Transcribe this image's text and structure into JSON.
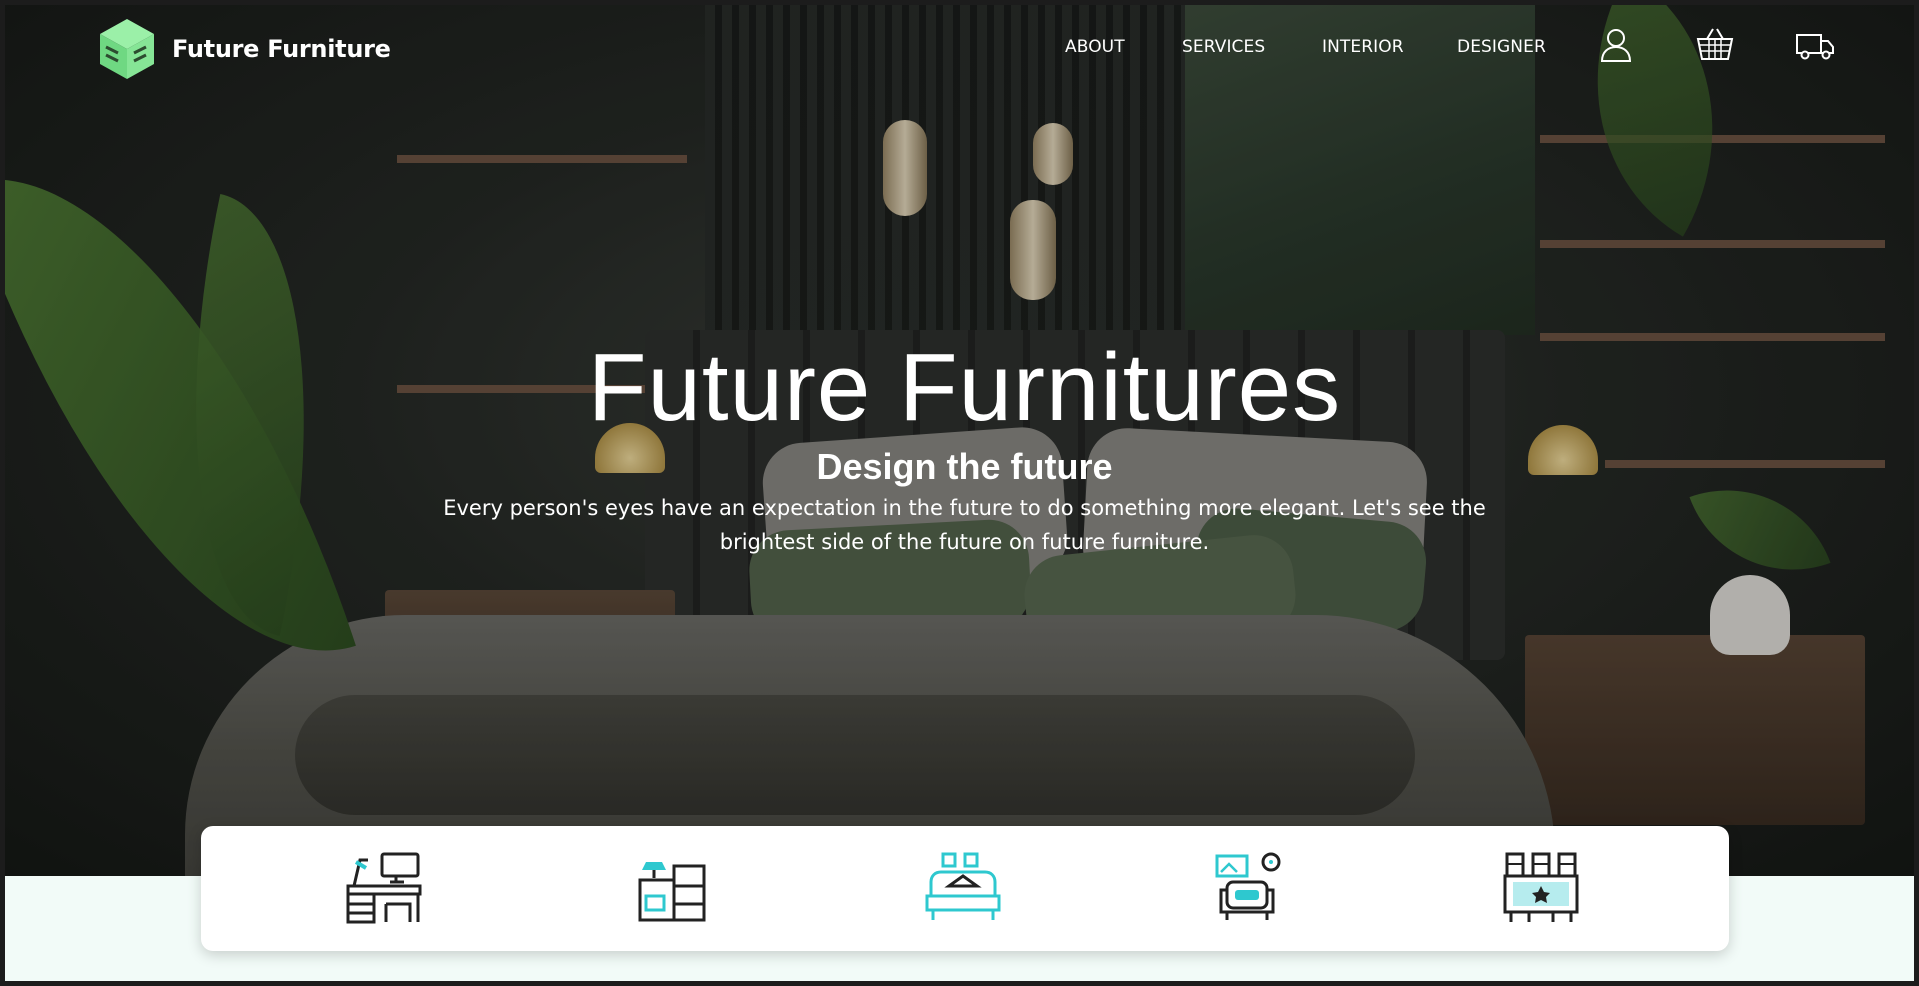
{
  "nav": {
    "brand": "Future Furniture",
    "logo_icon": "cube-logo-icon",
    "menu": [
      {
        "label": "ABOUT"
      },
      {
        "label": "SERVICES"
      },
      {
        "label": "INTERIOR"
      },
      {
        "label": "DESIGNER"
      }
    ],
    "icons": [
      "user-icon",
      "basket-icon",
      "delivery-truck-icon"
    ]
  },
  "hero": {
    "title": "Future Furnitures",
    "subtitle": "Design the future",
    "description": "Every person's eyes have an expectation in the future to do something more elegant. Let's see the brightest side of the future on future furniture."
  },
  "categories": [
    {
      "icon": "desk-workspace-icon"
    },
    {
      "icon": "cabinet-lamp-icon"
    },
    {
      "icon": "bed-icon"
    },
    {
      "icon": "armchair-picture-icon"
    },
    {
      "icon": "sideboard-icon"
    }
  ],
  "colors": {
    "accent": "#2ec8cf",
    "logo_green": "#7de38f",
    "page_bg": "#f2fbf8"
  }
}
